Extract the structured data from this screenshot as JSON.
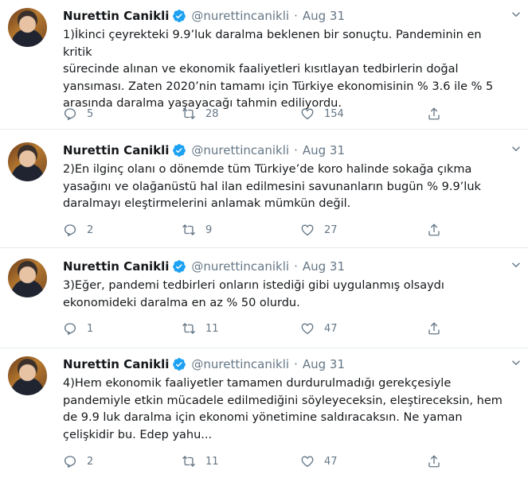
{
  "tweets": [
    {
      "name": "Nurettin Canikli",
      "handle": "@nurettincanikli",
      "dot": "·",
      "date": "Aug 31",
      "text": "1)İkinci çeyrekteki 9.9’luk daralma beklenen bir sonuçtu. Pandeminin en kritik\nsürecinde alınan ve ekonomik faaliyetleri kısıtlayan tedbirlerin doğal\nyansıması. Zaten 2020’nin tamamı için Türkiye ekonomisinin % 3.6 ile % 5\narasında daralma yaşayacağı tahmin ediliyordu.",
      "replies": "5",
      "retweets": "28",
      "likes": "154"
    },
    {
      "name": "Nurettin Canikli",
      "handle": "@nurettincanikli",
      "dot": "·",
      "date": "Aug 31",
      "text": "2)En ilginç olanı o dönemde tüm Türkiye’de koro halinde sokağa çıkma\nyasağını ve olağanüstü hal ilan edilmesini savunanların bugün % 9.9’luk\ndaralmayı eleştirmelerini anlamak mümkün değil.",
      "replies": "2",
      "retweets": "9",
      "likes": "27"
    },
    {
      "name": "Nurettin Canikli",
      "handle": "@nurettincanikli",
      "dot": "·",
      "date": "Aug 31",
      "text": "3)Eğer, pandemi tedbirleri onların istediği gibi uygulanmış olsaydı\nekonomideki daralma en az % 50 olurdu.",
      "replies": "1",
      "retweets": "11",
      "likes": "47"
    },
    {
      "name": "Nurettin Canikli",
      "handle": "@nurettincanikli",
      "dot": "·",
      "date": "Aug 31",
      "text": "4)Hem ekonomik faaliyetler tamamen durdurulmadığı gerekçesiyle\npandemiyle etkin mücadele edilmediğini söyleyeceksin, eleştireceksin, hem\nde 9.9 luk daralma için ekonomi yönetimine saldıracaksın. Ne yaman\nçelişkidir bu. Edep yahu...",
      "replies": "2",
      "retweets": "11",
      "likes": "47"
    }
  ],
  "icons": {
    "verified": "verified-badge-icon",
    "caret": "chevron-down-icon",
    "reply": "reply-icon",
    "retweet": "retweet-icon",
    "like": "heart-icon",
    "share": "share-icon"
  },
  "colors": {
    "name": "#14171a",
    "secondary": "#657786",
    "verified": "#1da1f2",
    "divider": "#e6ecf0"
  }
}
